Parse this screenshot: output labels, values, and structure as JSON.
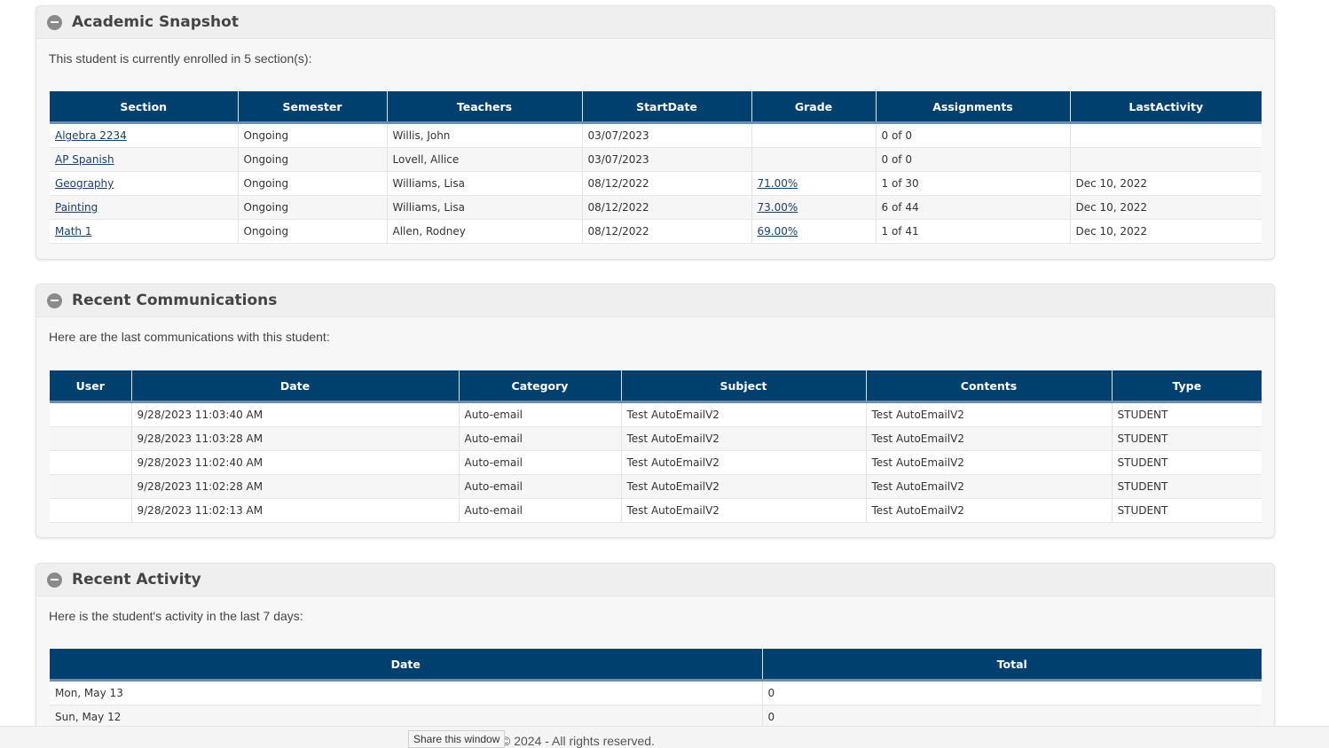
{
  "academic": {
    "title": "Academic Snapshot",
    "description": "This student is currently enrolled in 5 section(s):",
    "columns": [
      "Section",
      "Semester",
      "Teachers",
      "StartDate",
      "Grade",
      "Assignments",
      "LastActivity"
    ],
    "rows": [
      {
        "section": "Algebra 2234",
        "semester": "Ongoing",
        "teachers": "Willis, John",
        "start": "03/07/2023",
        "grade": "",
        "assignments": "0 of 0",
        "last": ""
      },
      {
        "section": "AP Spanish",
        "semester": "Ongoing",
        "teachers": "Lovell, Allice",
        "start": "03/07/2023",
        "grade": "",
        "assignments": "0 of 0",
        "last": ""
      },
      {
        "section": "Geography",
        "semester": "Ongoing",
        "teachers": "Williams, Lisa",
        "start": "08/12/2022",
        "grade": "71.00%",
        "assignments": "1 of 30",
        "last": "Dec 10, 2022"
      },
      {
        "section": "Painting",
        "semester": "Ongoing",
        "teachers": "Williams, Lisa",
        "start": "08/12/2022",
        "grade": "73.00%",
        "assignments": "6 of 44",
        "last": "Dec 10, 2022"
      },
      {
        "section": "Math 1",
        "semester": "Ongoing",
        "teachers": "Allen, Rodney",
        "start": "08/12/2022",
        "grade": "69.00%",
        "assignments": "1 of 41",
        "last": "Dec 10, 2022"
      }
    ]
  },
  "communications": {
    "title": "Recent Communications",
    "description": "Here are the last communications with this student:",
    "columns": [
      "User",
      "Date",
      "Category",
      "Subject",
      "Contents",
      "Type"
    ],
    "rows": [
      {
        "user": "",
        "date": "9/28/2023 11:03:40 AM",
        "category": "Auto-email",
        "subject": "Test AutoEmailV2",
        "contents": "Test AutoEmailV2",
        "type": "STUDENT"
      },
      {
        "user": "",
        "date": "9/28/2023 11:03:28 AM",
        "category": "Auto-email",
        "subject": "Test AutoEmailV2",
        "contents": "Test AutoEmailV2",
        "type": "STUDENT"
      },
      {
        "user": "",
        "date": "9/28/2023 11:02:40 AM",
        "category": "Auto-email",
        "subject": "Test AutoEmailV2",
        "contents": "Test AutoEmailV2",
        "type": "STUDENT"
      },
      {
        "user": "",
        "date": "9/28/2023 11:02:28 AM",
        "category": "Auto-email",
        "subject": "Test AutoEmailV2",
        "contents": "Test AutoEmailV2",
        "type": "STUDENT"
      },
      {
        "user": "",
        "date": "9/28/2023 11:02:13 AM",
        "category": "Auto-email",
        "subject": "Test AutoEmailV2",
        "contents": "Test AutoEmailV2",
        "type": "STUDENT"
      }
    ]
  },
  "activity": {
    "title": "Recent Activity",
    "description": "Here is the student's activity in the last 7 days:",
    "columns": [
      "Date",
      "Total"
    ],
    "rows": [
      {
        "date": "Mon, May 13",
        "total": "0"
      },
      {
        "date": "Sun, May 12",
        "total": "0"
      }
    ]
  },
  "footer": {
    "copyright": "© 2024 - All rights reserved.",
    "share_tooltip": "Share this window"
  },
  "colors": {
    "header_bg": "#00406e",
    "link": "#1d3f66"
  }
}
